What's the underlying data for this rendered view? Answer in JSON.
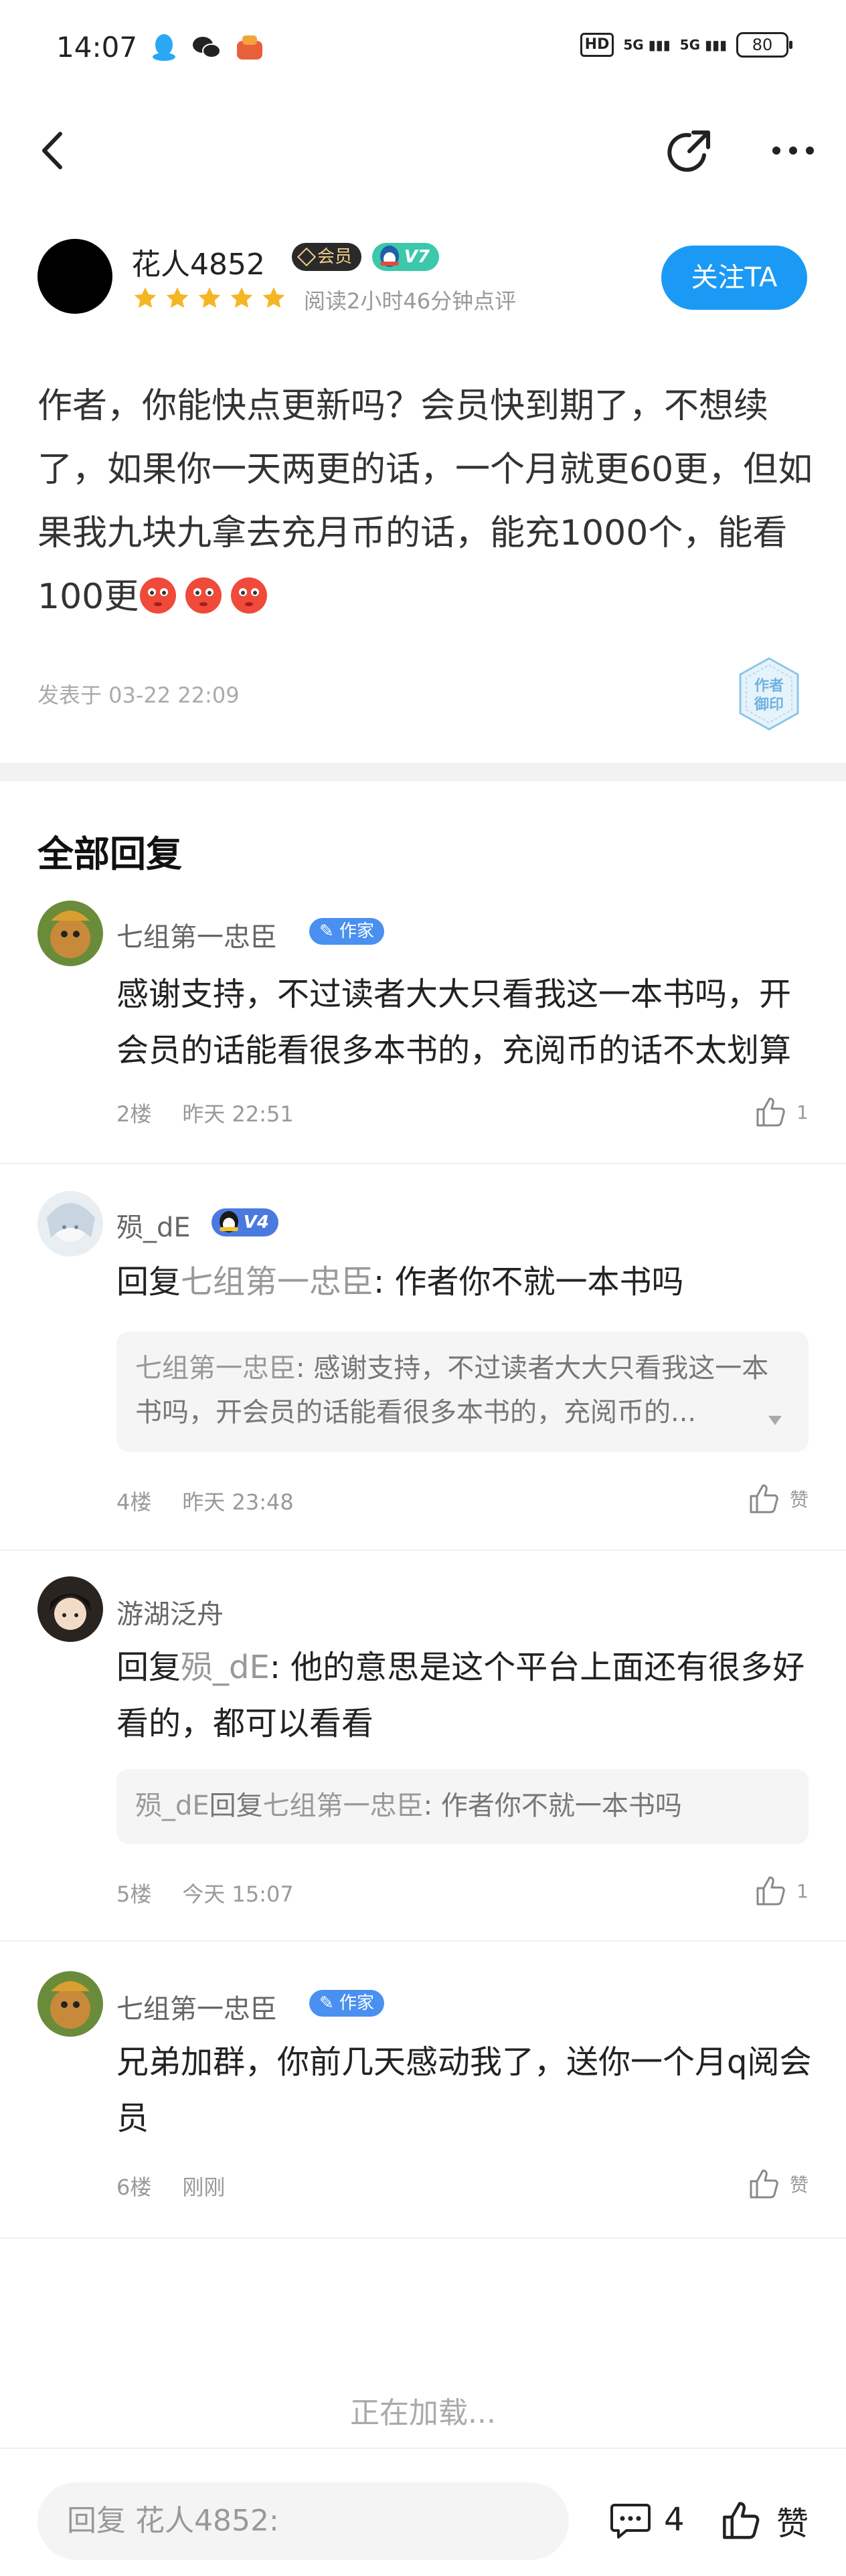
{
  "status_bar": {
    "time": "14:07",
    "battery": "80",
    "network1": "5G",
    "network2": "5G",
    "hd": "HD"
  },
  "author": {
    "name": "花人4852",
    "vip_label": "会员",
    "level_label": "V7",
    "rating": 5,
    "read_time": "阅读2小时46分钟点评",
    "follow_label": "关注TA"
  },
  "post": {
    "text": "作者，你能快点更新吗？会员快到期了，不想续了，如果你一天两更的话，一个月就更60更，但如果我九块九拿去充月币的话，能充1000个，能看100更",
    "date": "发表于 03-22 22:09",
    "stamp_text": "作者\n御印"
  },
  "section_title": "全部回复",
  "replies": [
    {
      "name": "七组第一忠臣",
      "badge": "作家",
      "text": "感谢支持，不过读者大大只看我这一本书吗，开会员的话能看很多本书的，充阅币的话不太划算",
      "floor": "2楼",
      "time": "昨天 22:51",
      "likes": "1"
    },
    {
      "name": "殒_dE",
      "badge": "V4",
      "reply_prefix": "回复",
      "reply_to": "七组第一忠臣",
      "text": ": 作者你不就一本书吗",
      "quote_name": "七组第一忠臣",
      "quote_text": ": 感谢支持，不过读者大大只看我这一本书吗，开会员的话能看很多本书的，充阅币的...",
      "floor": "4楼",
      "time": "昨天 23:48",
      "likes": "赞"
    },
    {
      "name": "游湖泛舟",
      "reply_prefix": "回复",
      "reply_to": "殒_dE",
      "text": ": 他的意思是这个平台上面还有很多好看的，都可以看看",
      "quote_name": "殒_dE",
      "quote_mid": "回复",
      "quote_name2": "七组第一忠臣",
      "quote_text": ": 作者你不就一本书吗",
      "floor": "5楼",
      "time": "今天 15:07",
      "likes": "1"
    },
    {
      "name": "七组第一忠臣",
      "badge": "作家",
      "text": "兄弟加群，你前几天感动我了，送你一个月q阅会员",
      "floor": "6楼",
      "time": "刚刚",
      "likes": "赞"
    }
  ],
  "loading_text": "正在加载...",
  "bottom_bar": {
    "input_placeholder": "回复 花人4852:",
    "comment_count": "4",
    "like_label": "赞"
  },
  "colors": {
    "accent": "#1b9af5",
    "writer_badge": "#4a90f0",
    "level_badge": "#3cc8aa",
    "star": "#f5b623"
  }
}
